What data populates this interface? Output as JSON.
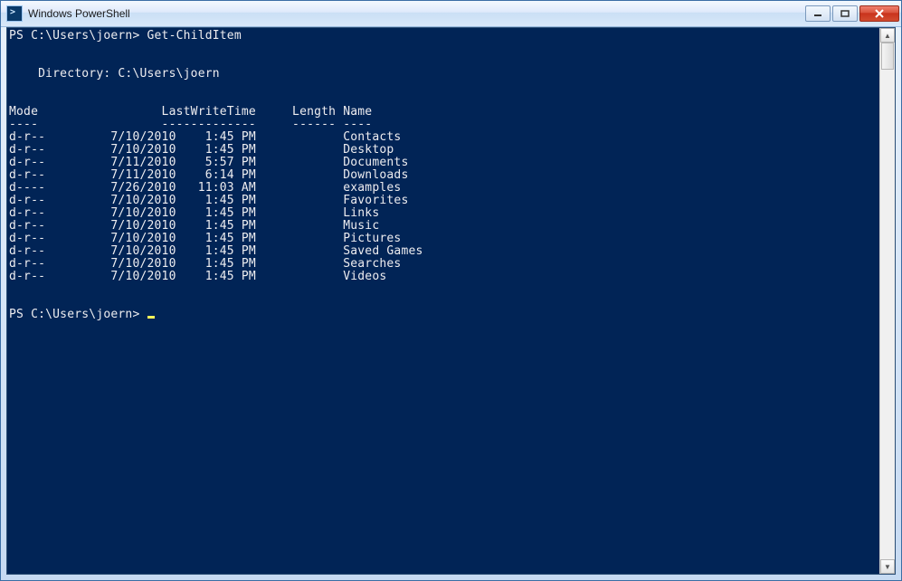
{
  "window": {
    "title": "Windows PowerShell"
  },
  "prompt1": {
    "ps": "PS C:\\Users\\joern> ",
    "command": "Get-ChildItem"
  },
  "directory_line": "    Directory: C:\\Users\\joern",
  "headers": {
    "mode": "Mode",
    "lwt": "LastWriteTime",
    "length": "Length",
    "name": "Name"
  },
  "underlines": {
    "mode": "----",
    "lwt": "-------------",
    "length": "------",
    "name": "----"
  },
  "rows": [
    {
      "mode": "d-r--",
      "date": "7/10/2010",
      "time": "1:45 PM",
      "name": "Contacts"
    },
    {
      "mode": "d-r--",
      "date": "7/10/2010",
      "time": "1:45 PM",
      "name": "Desktop"
    },
    {
      "mode": "d-r--",
      "date": "7/11/2010",
      "time": "5:57 PM",
      "name": "Documents"
    },
    {
      "mode": "d-r--",
      "date": "7/11/2010",
      "time": "6:14 PM",
      "name": "Downloads"
    },
    {
      "mode": "d----",
      "date": "7/26/2010",
      "time": "11:03 AM",
      "name": "examples"
    },
    {
      "mode": "d-r--",
      "date": "7/10/2010",
      "time": "1:45 PM",
      "name": "Favorites"
    },
    {
      "mode": "d-r--",
      "date": "7/10/2010",
      "time": "1:45 PM",
      "name": "Links"
    },
    {
      "mode": "d-r--",
      "date": "7/10/2010",
      "time": "1:45 PM",
      "name": "Music"
    },
    {
      "mode": "d-r--",
      "date": "7/10/2010",
      "time": "1:45 PM",
      "name": "Pictures"
    },
    {
      "mode": "d-r--",
      "date": "7/10/2010",
      "time": "1:45 PM",
      "name": "Saved Games"
    },
    {
      "mode": "d-r--",
      "date": "7/10/2010",
      "time": "1:45 PM",
      "name": "Searches"
    },
    {
      "mode": "d-r--",
      "date": "7/10/2010",
      "time": "1:45 PM",
      "name": "Videos"
    }
  ],
  "prompt2": {
    "ps": "PS C:\\Users\\joern> "
  },
  "col_widths": {
    "mode": 13,
    "date": 10,
    "time": 10,
    "length": 7,
    "pad_before_date": 0,
    "lwt_total": 21,
    "name_lead": 0
  }
}
